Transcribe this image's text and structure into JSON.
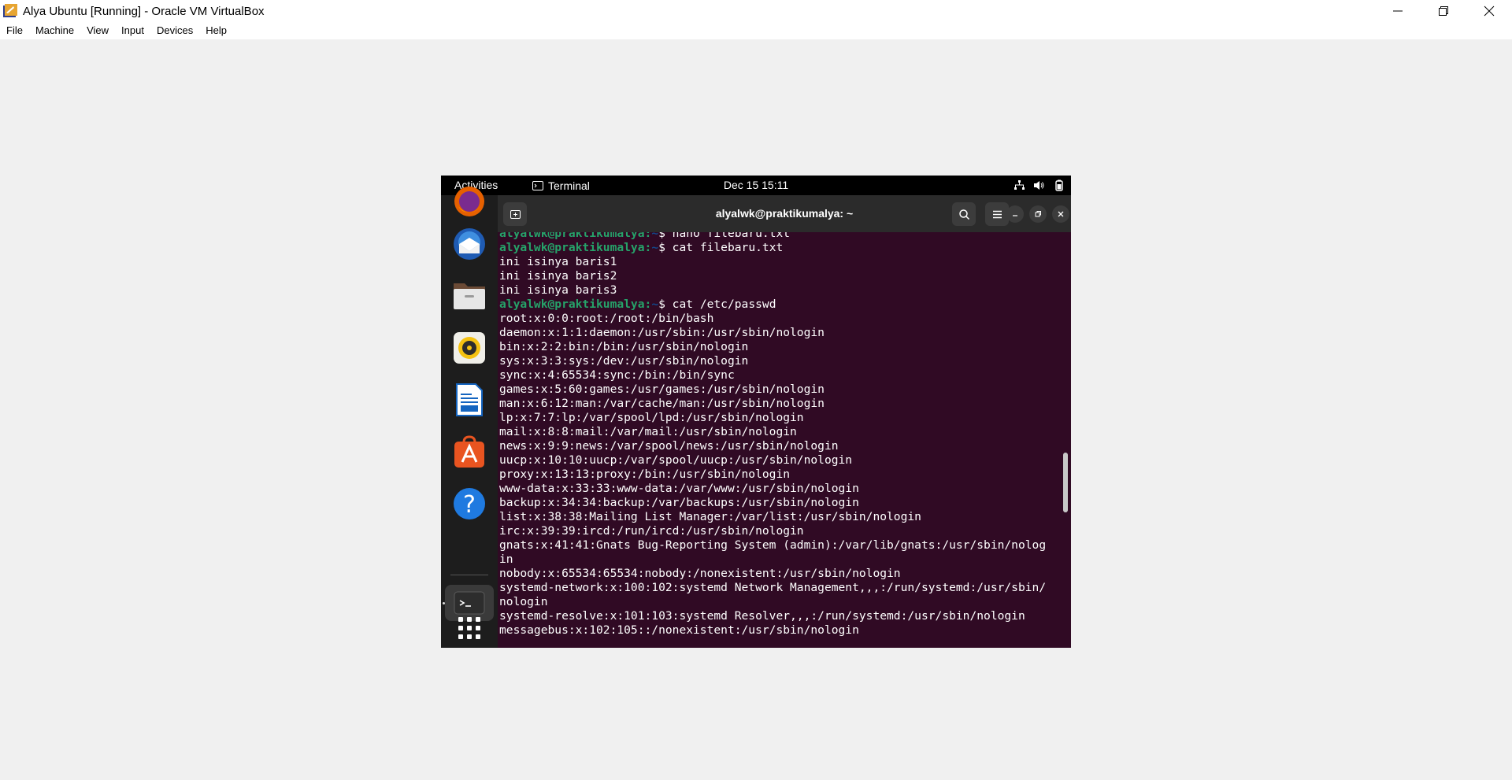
{
  "host": {
    "title": "Alya Ubuntu [Running] - Oracle VM VirtualBox",
    "menu": [
      "File",
      "Machine",
      "View",
      "Input",
      "Devices",
      "Help"
    ]
  },
  "gnome": {
    "activities": "Activities",
    "app_name": "Terminal",
    "clock": "Dec 15  15:11"
  },
  "dock": {
    "items": [
      "firefox-icon",
      "thunderbird-icon",
      "files-icon",
      "rhythmbox-icon",
      "libreoffice-writer-icon",
      "app-center-icon",
      "help-icon",
      "terminal-icon",
      "show-apps-icon"
    ]
  },
  "terminal": {
    "title": "alyalwk@praktikumalya: ~",
    "lines": [
      {
        "user": "alyalwk@praktikumalya",
        "path": "~",
        "cmd": "$ nano filebaru.txt"
      },
      {
        "user": "alyalwk@praktikumalya",
        "path": "~",
        "cmd": "$ cat filebaru.txt"
      },
      {
        "text": "ini isinya baris1"
      },
      {
        "text": "ini isinya baris2"
      },
      {
        "text": "ini isinya baris3"
      },
      {
        "user": "alyalwk@praktikumalya",
        "path": "~",
        "cmd": "$ cat /etc/passwd"
      },
      {
        "text": "root:x:0:0:root:/root:/bin/bash"
      },
      {
        "text": "daemon:x:1:1:daemon:/usr/sbin:/usr/sbin/nologin"
      },
      {
        "text": "bin:x:2:2:bin:/bin:/usr/sbin/nologin"
      },
      {
        "text": "sys:x:3:3:sys:/dev:/usr/sbin/nologin"
      },
      {
        "text": "sync:x:4:65534:sync:/bin:/bin/sync"
      },
      {
        "text": "games:x:5:60:games:/usr/games:/usr/sbin/nologin"
      },
      {
        "text": "man:x:6:12:man:/var/cache/man:/usr/sbin/nologin"
      },
      {
        "text": "lp:x:7:7:lp:/var/spool/lpd:/usr/sbin/nologin"
      },
      {
        "text": "mail:x:8:8:mail:/var/mail:/usr/sbin/nologin"
      },
      {
        "text": "news:x:9:9:news:/var/spool/news:/usr/sbin/nologin"
      },
      {
        "text": "uucp:x:10:10:uucp:/var/spool/uucp:/usr/sbin/nologin"
      },
      {
        "text": "proxy:x:13:13:proxy:/bin:/usr/sbin/nologin"
      },
      {
        "text": "www-data:x:33:33:www-data:/var/www:/usr/sbin/nologin"
      },
      {
        "text": "backup:x:34:34:backup:/var/backups:/usr/sbin/nologin"
      },
      {
        "text": "list:x:38:38:Mailing List Manager:/var/list:/usr/sbin/nologin"
      },
      {
        "text": "irc:x:39:39:ircd:/run/ircd:/usr/sbin/nologin"
      },
      {
        "text": "gnats:x:41:41:Gnats Bug-Reporting System (admin):/var/lib/gnats:/usr/sbin/nolog"
      },
      {
        "text": "in"
      },
      {
        "text": "nobody:x:65534:65534:nobody:/nonexistent:/usr/sbin/nologin"
      },
      {
        "text": "systemd-network:x:100:102:systemd Network Management,,,:/run/systemd:/usr/sbin/"
      },
      {
        "text": "nologin"
      },
      {
        "text": "systemd-resolve:x:101:103:systemd Resolver,,,:/run/systemd:/usr/sbin/nologin"
      },
      {
        "text": "messagebus:x:102:105::/nonexistent:/usr/sbin/nologin"
      }
    ]
  },
  "colors": {
    "terminal_bg": "#300a24",
    "prompt_user": "#26a269",
    "prompt_path": "#12488b"
  }
}
